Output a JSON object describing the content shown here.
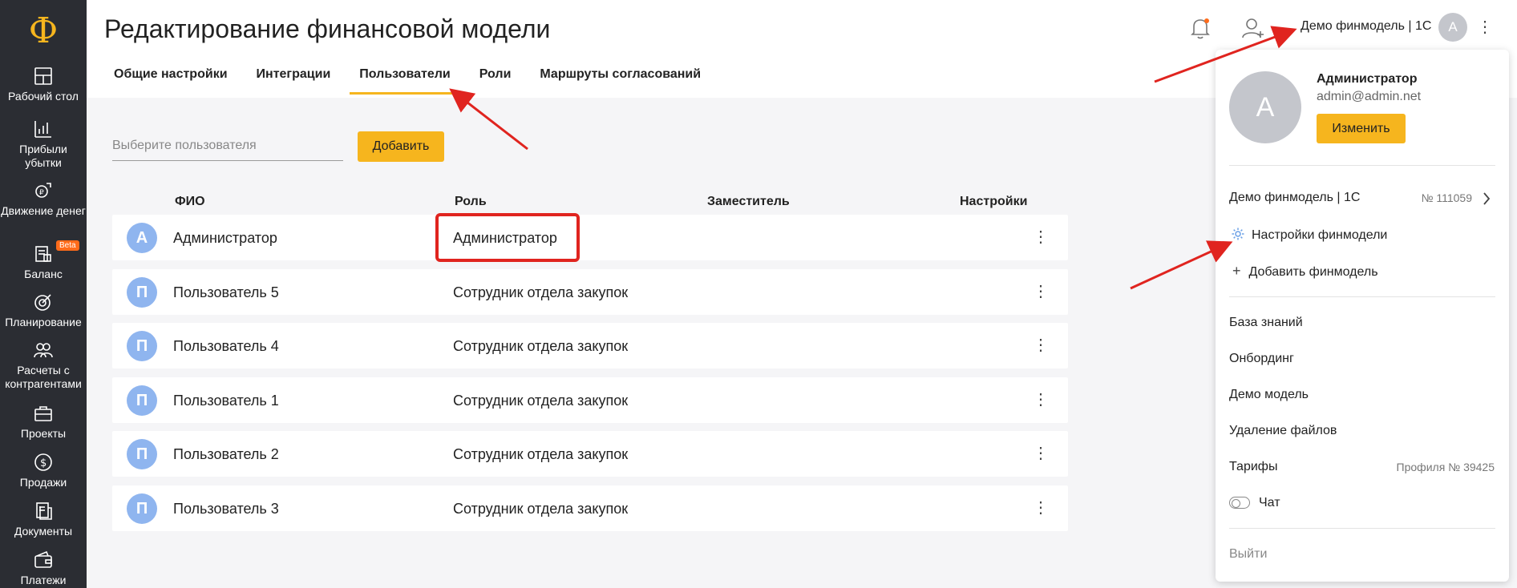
{
  "sidebar": {
    "logo": "Ф",
    "items": [
      {
        "label": "Рабочий стол",
        "icon": "dashboard-icon"
      },
      {
        "label": "Прибыли убытки",
        "icon": "bar-chart-icon"
      },
      {
        "label": "Движение денег",
        "icon": "money-flow-icon"
      },
      {
        "label": "Баланс",
        "icon": "balance-icon",
        "badge": "Beta"
      },
      {
        "label": "Планирование",
        "icon": "target-icon"
      },
      {
        "label": "Расчеты с контрагентами",
        "icon": "contractors-icon"
      },
      {
        "label": "Проекты",
        "icon": "briefcase-icon"
      },
      {
        "label": "Продажи",
        "icon": "dollar-icon"
      },
      {
        "label": "Документы",
        "icon": "documents-icon"
      },
      {
        "label": "Платежи",
        "icon": "wallet-icon"
      }
    ]
  },
  "header": {
    "title": "Редактирование финансовой модели",
    "tabs": [
      {
        "label": "Общие настройки",
        "active": false
      },
      {
        "label": "Интеграции",
        "active": false
      },
      {
        "label": "Пользователи",
        "active": true
      },
      {
        "label": "Роли",
        "active": false
      },
      {
        "label": "Маршруты согласований",
        "active": false
      }
    ],
    "finmodel_label": "Демо финмодель | 1С",
    "avatar_letter": "А"
  },
  "users": {
    "select_placeholder": "Выберите пользователя",
    "add_button": "Добавить",
    "columns": [
      "ФИО",
      "Роль",
      "Заместитель",
      "Настройки"
    ],
    "rows": [
      {
        "avatar": "А",
        "name": "Администратор",
        "role": "Администратор"
      },
      {
        "avatar": "П",
        "name": "Пользователь 5",
        "role": "Сотрудник отдела закупок"
      },
      {
        "avatar": "П",
        "name": "Пользователь 4",
        "role": "Сотрудник отдела закупок"
      },
      {
        "avatar": "П",
        "name": "Пользователь 1",
        "role": "Сотрудник отдела закупок"
      },
      {
        "avatar": "П",
        "name": "Пользователь 2",
        "role": "Сотрудник отдела закупок"
      },
      {
        "avatar": "П",
        "name": "Пользователь 3",
        "role": "Сотрудник отдела закупок"
      }
    ]
  },
  "dropdown": {
    "avatar_letter": "А",
    "name": "Администратор",
    "email": "admin@admin.net",
    "edit_button": "Изменить",
    "finmodel": "Демо финмодель | 1С",
    "finmodel_number": "№ 111059",
    "settings": "Настройки финмодели",
    "add_finmodel": "Добавить финмодель",
    "knowledge_base": "База знаний",
    "onboarding": "Онбординг",
    "demo_model": "Демо модель",
    "delete_files": "Удаление файлов",
    "tariffs": "Тарифы",
    "profile_number": "Профиля № 39425",
    "chat": "Чат",
    "logout": "Выйти"
  },
  "colors": {
    "accent": "#f6b51e",
    "sidebar_bg": "#2b2d33",
    "avatar_blue": "#8fb5ef",
    "annotation_red": "#e0241f"
  }
}
